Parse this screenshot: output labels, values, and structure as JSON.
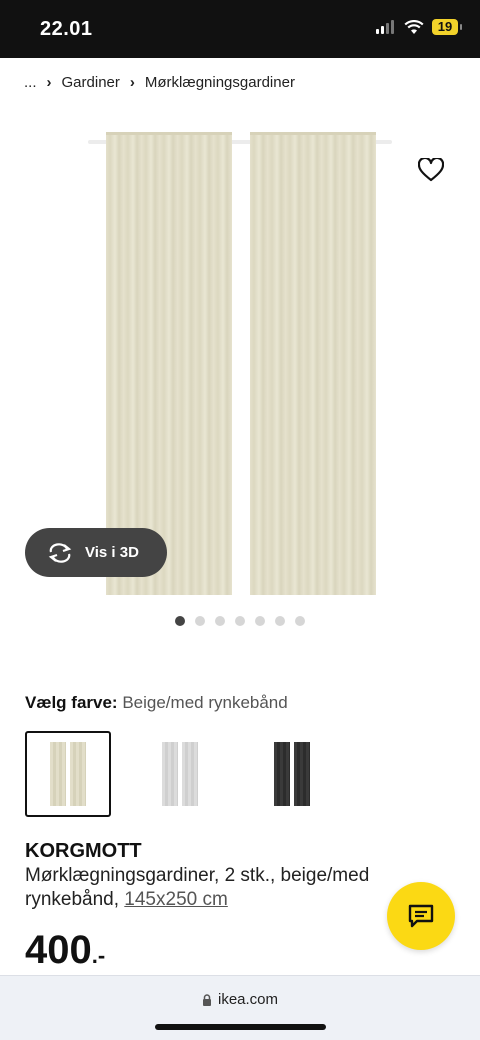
{
  "status_bar": {
    "time": "22.01",
    "battery": "19"
  },
  "breadcrumb": {
    "ellipsis": "...",
    "items": [
      "Gardiner",
      "Mørklægningsgardiner"
    ]
  },
  "gallery": {
    "view3d_label": "Vis i 3D",
    "dot_count": 7,
    "active_dot": 0
  },
  "color": {
    "label": "Vælg farve:",
    "value": "Beige/med rynkebånd",
    "options": [
      "beige",
      "light-grey",
      "dark-grey"
    ],
    "selected": 0
  },
  "product": {
    "name": "KORGMOTT",
    "description": "Mørklægningsgardiner, 2 stk., beige/med rynkebånd, ",
    "size": "145x250 cm",
    "price": "400",
    "price_suffix": ".-"
  },
  "browser": {
    "url": "ikea.com"
  },
  "colors": {
    "accent": "#fbd914",
    "dark_button": "#444444"
  }
}
